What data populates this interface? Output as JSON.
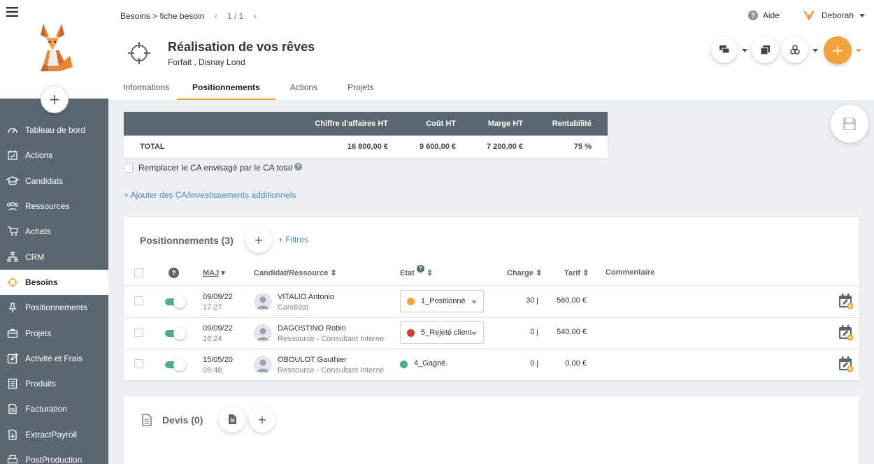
{
  "nav": {
    "items": [
      {
        "label": "Tableau de bord",
        "icon": "dashboard-icon",
        "active": false
      },
      {
        "label": "Actions",
        "icon": "calendar-check-icon",
        "active": false
      },
      {
        "label": "Candidats",
        "icon": "graduation-cap-icon",
        "active": false
      },
      {
        "label": "Ressources",
        "icon": "people-icon",
        "active": false
      },
      {
        "label": "Achats",
        "icon": "cart-icon",
        "active": false
      },
      {
        "label": "CRM",
        "icon": "org-chart-icon",
        "active": false
      },
      {
        "label": "Besoins",
        "icon": "crosshair-icon",
        "active": true
      },
      {
        "label": "Positionnements",
        "icon": "pin-icon",
        "active": false
      },
      {
        "label": "Projets",
        "icon": "briefcase-icon",
        "active": false
      },
      {
        "label": "Activité et Frais",
        "icon": "edit-icon",
        "active": false
      },
      {
        "label": "Produits",
        "icon": "list-icon",
        "active": false
      },
      {
        "label": "Facturation",
        "icon": "invoice-icon",
        "active": false
      },
      {
        "label": "ExtractPayroll",
        "icon": "export-icon",
        "active": false
      },
      {
        "label": "PostProduction",
        "icon": "printer-icon",
        "active": false
      }
    ]
  },
  "header": {
    "breadcrumb": "Besoins > fiche besoin",
    "pager": {
      "prev": "‹",
      "count": "1 / 1",
      "next": "›"
    },
    "help_label": "Aide",
    "user_name": "Deborah",
    "title": "Réalisation de vos rêves",
    "subtitle_prefix": "Forfait , ",
    "subtitle_client": "Disnay Lond",
    "tabs": [
      "Informations",
      "Positionnements",
      "Actions",
      "Projets"
    ],
    "active_tab": "Positionnements",
    "plus_label": "+"
  },
  "totals": {
    "headers": {
      "ca": "Chiffre d'affaires HT",
      "cout": "Coût HT",
      "marge": "Marge HT",
      "rent": "Rentabilité"
    },
    "row": {
      "label": "TOTAL",
      "ca": "16 800,00 €",
      "cout": "9 600,00 €",
      "marge": "7 200,00 €",
      "rent": "75 %"
    }
  },
  "replace_label": "Remplacer le CA envisagé par le CA total",
  "help_mark": "?",
  "add_ca_label": "+ Ajouter des CA/investissements additionnels",
  "positionnements": {
    "title": "Positionnements (3)",
    "add_label": "+",
    "filters_label": "+ Filtres",
    "columns": {
      "help": "?",
      "maj": "MAJ",
      "candidat": "Candidat/Ressource",
      "etat": "Etat",
      "charge": "Charge",
      "tarif": "Tarif",
      "commentaire": "Commentaire"
    },
    "rows": [
      {
        "date": "09/09/22",
        "time": "17:27",
        "name": "VITALIO Antonio",
        "role": "Candidat",
        "etat": "1_Positionné",
        "etat_color": "#f2a23c",
        "etat_select": true,
        "charge": "30 j",
        "tarif": "560,00 €"
      },
      {
        "date": "09/09/22",
        "time": "16:24",
        "name": "DAGOSTINO Robin",
        "role": "Ressource - Consultant Interne",
        "etat": "5_Rejeté client",
        "etat_color": "#d0402b",
        "etat_select": true,
        "charge": "0 j",
        "tarif": "540,00 €"
      },
      {
        "date": "15/05/20",
        "time": "09:48",
        "name": "OBOULOT Gauthier",
        "role": "Ressource - Consultant Interne",
        "etat": "4_Gagné",
        "etat_color": "#4fae8a",
        "etat_select": false,
        "charge": "0 j",
        "tarif": "0,00 €"
      }
    ]
  },
  "devis": {
    "title": "Devis (0)",
    "add_label": "+"
  },
  "colors": {
    "sidebar": "#5b6770",
    "accent": "#f2a23c",
    "link": "#4a8ab0",
    "toggle_on": "#4fae8a"
  }
}
